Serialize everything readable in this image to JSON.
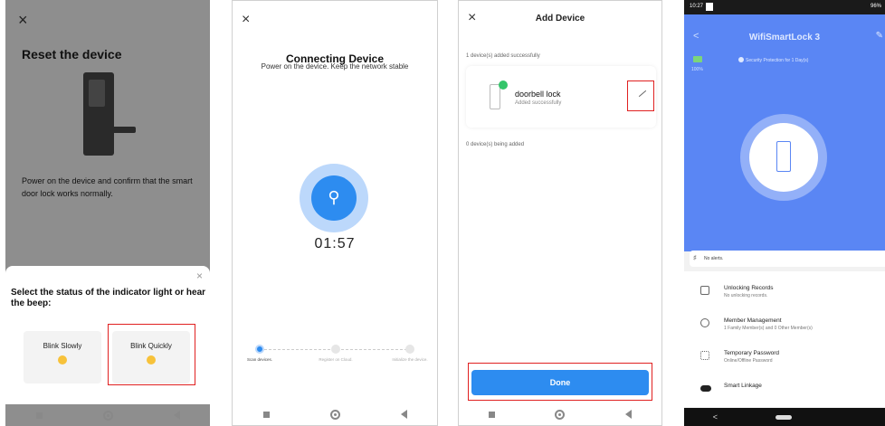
{
  "panel1": {
    "close": "×",
    "title": "Reset the device",
    "description": "Power on the device and confirm that the smart door lock works normally.",
    "sheet": {
      "close": "×",
      "question": "Select the status of the indicator light or hear the beep:",
      "options": [
        {
          "label": "Blink Slowly"
        },
        {
          "label": "Blink Quickly"
        }
      ]
    }
  },
  "panel2": {
    "close": "×",
    "title": "Connecting Device",
    "subtitle": "Power on the device. Keep the network stable",
    "timer": "01:57",
    "steps": [
      {
        "label": "Scan devices."
      },
      {
        "label": "Register on Cloud."
      },
      {
        "label": "Initialize the device."
      }
    ]
  },
  "panel3": {
    "close": "×",
    "title": "Add Device",
    "added_text": "1 device(s) added successfully",
    "device": {
      "name": "doorbell lock",
      "status": "Added successfully"
    },
    "adding_text": "0 device(s) being added",
    "done": "Done"
  },
  "panel4": {
    "status_time": "10:27",
    "status_right": "96%",
    "title": "WifiSmartLock 3",
    "battery": "100%",
    "security": "Security Protection for 1 Day(s)",
    "alert": "No alerts.",
    "menu": [
      {
        "label": "Unlocking Records",
        "sub": "No unlocking records."
      },
      {
        "label": "Member Management",
        "sub": "1 Family Member(s) and 0 Other Member(s)"
      },
      {
        "label": "Temporary Password",
        "sub": "Online/Offline Password"
      },
      {
        "label": "Smart Linkage",
        "sub": ""
      }
    ]
  }
}
